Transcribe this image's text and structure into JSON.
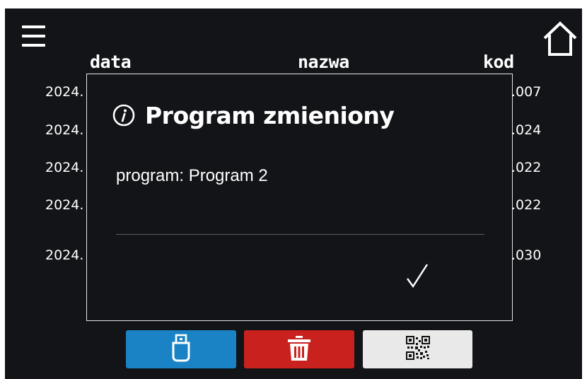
{
  "table": {
    "headers": {
      "date": "data",
      "name": "nazwa",
      "code": "kod"
    },
    "rows": [
      {
        "date": "2024.",
        "code": ".007"
      },
      {
        "date": "2024.",
        "code": ".024"
      },
      {
        "date": "2024.",
        "code": ".022"
      },
      {
        "date": "2024.",
        "code": ".022"
      },
      {
        "date": "2024.",
        "code": ".030"
      }
    ]
  },
  "dialog": {
    "icon": "info-icon",
    "title": "Program zmieniony",
    "message": "program: Program 2",
    "confirm_icon": "checkmark-icon"
  },
  "toolbar": {
    "usb_icon": "usb-icon",
    "delete_icon": "trash-icon",
    "qr_icon": "qr-code-icon"
  },
  "colors": {
    "background": "#121418",
    "usb_button": "#1a83c6",
    "delete_button": "#c9211e",
    "qr_button": "#e9e9e9",
    "dialog_border": "#e6e6e6"
  }
}
